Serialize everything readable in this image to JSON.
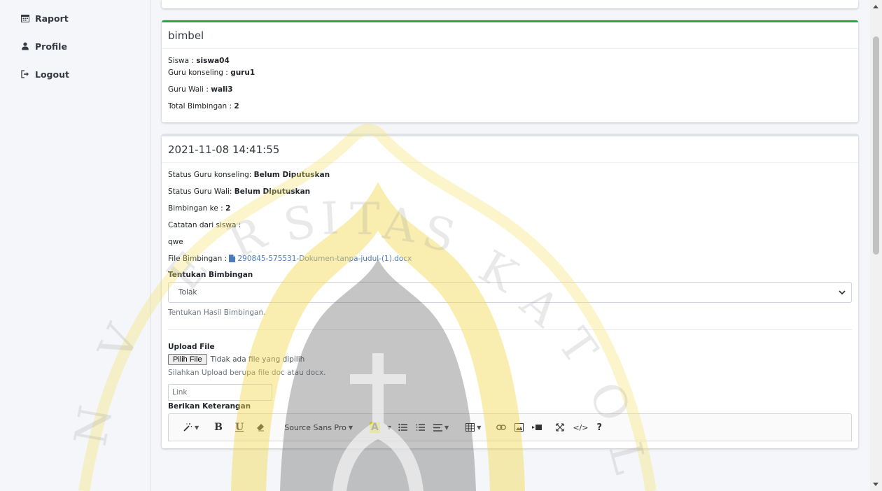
{
  "sidebar": {
    "items": [
      {
        "label": "Raport",
        "icon": "calendar-icon"
      },
      {
        "label": "Profile",
        "icon": "user-icon"
      },
      {
        "label": "Logout",
        "icon": "sign-out-icon"
      }
    ]
  },
  "bimbel_card": {
    "title": "bimbel",
    "siswa_label": "Siswa : ",
    "siswa_value": "siswa04",
    "guru_konseling_label": "Guru konseling : ",
    "guru_konseling_value": "guru1",
    "guru_wali_label": "Guru Wali : ",
    "guru_wali_value": "wali3",
    "total_label": "Total Bimbingan : ",
    "total_value": "2"
  },
  "session_card": {
    "title": "2021-11-08 14:41:55",
    "status_konseling_label": "Status Guru konseling: ",
    "status_konseling_value": "Belum Diputuskan",
    "status_wali_label": "Status Guru Wali: ",
    "status_wali_value": "Belum Diputuskan",
    "bimbingan_ke_label": "Bimbingan ke : ",
    "bimbingan_ke_value": "2",
    "catatan_label": "Catatan dari siswa :",
    "catatan_value": "qwe",
    "file_label": "File Bimbingan : ",
    "file_name": "290845-575531-Dokumen-tanpa-judul-(1).docx"
  },
  "form": {
    "tentukan_label": "Tentukan Bimbingan",
    "tentukan_selected": "Tolak",
    "tentukan_help": "Tentukan Hasil Bimbingan.",
    "upload_label": "Upload File",
    "file_button": "Pilih File",
    "file_status": "Tidak ada file yang dipilih",
    "upload_help": "Silahkan Upload berupa file doc atau docx.",
    "link_placeholder": "Link",
    "keterangan_label": "Berikan Keterangan"
  },
  "editor_toolbar": {
    "bold": "B",
    "underline": "U",
    "font_name": "Source Sans Pro",
    "color_letter": "A",
    "code": "</>",
    "help": "?"
  },
  "watermark_text": "UNIVERSITAS KATOLIK",
  "colors": {
    "card_accent": "#28a745",
    "link": "#4d7ab8",
    "watermark": "#f5e36b"
  }
}
